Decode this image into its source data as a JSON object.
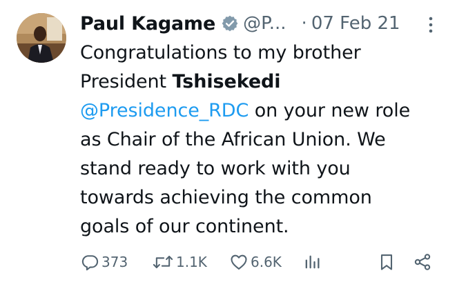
{
  "author": {
    "name": "Paul Kagame",
    "handle": "@P...",
    "separator": "·",
    "date": "07 Feb 21"
  },
  "tweet": {
    "line1": "Congratulations to my brother",
    "line2_prefix": "President ",
    "line2_bold": "Tshisekedi",
    "mention": "@Presidence_RDC",
    "after_mention": " on your new role",
    "line4": "as Chair of the African Union. We",
    "line5": "stand ready to work with you",
    "line6": "towards achieving the common",
    "line7": "goals of our continent."
  },
  "actions": {
    "replies": "373",
    "retweets": "1.1K",
    "likes": "6.6K"
  },
  "icons": {
    "verified": "verified-badge-icon",
    "more": "more-vertical-icon",
    "reply": "reply-icon",
    "retweet": "retweet-icon",
    "like": "heart-icon",
    "views": "views-bar-chart-icon",
    "bookmark": "bookmark-icon",
    "share": "share-icon"
  },
  "colors": {
    "text": "#0f1419",
    "secondary": "#536471",
    "link": "#1d9bf0"
  }
}
